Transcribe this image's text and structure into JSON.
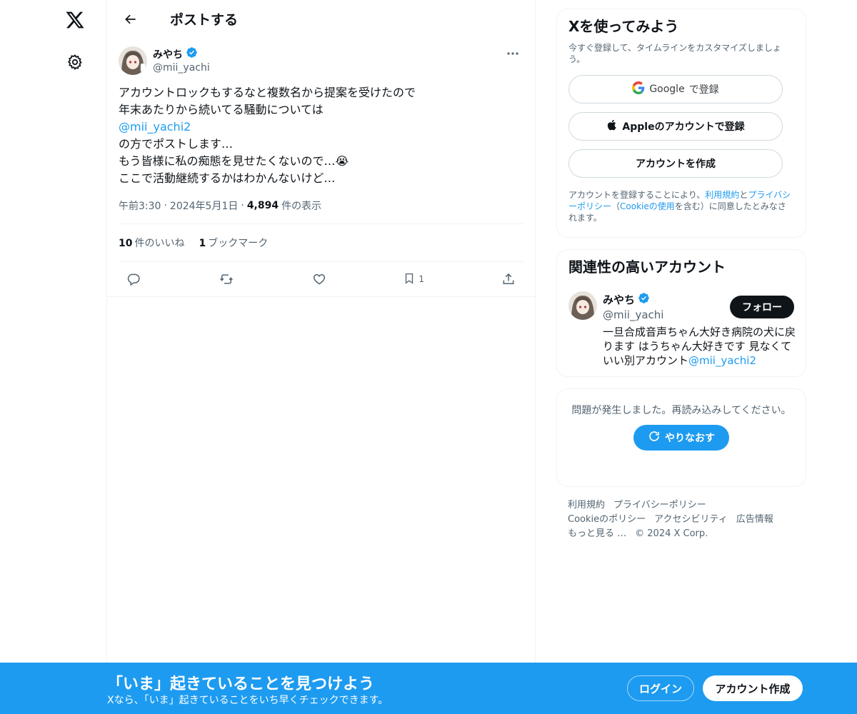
{
  "colors": {
    "accent": "#1d9bf0",
    "text": "#0f1419",
    "subtext": "#536471",
    "border": "#eff3f4",
    "dark_button": "#0f1419"
  },
  "nav": {
    "logo_icon": "x-logo-icon",
    "settings_icon": "gear-icon"
  },
  "header": {
    "back_icon": "arrow-left-icon",
    "title": "ポストする"
  },
  "post": {
    "author": {
      "name": "みやち",
      "handle": "@mii_yachi",
      "verified_icon": "verified-badge-icon"
    },
    "more_icon": "more-dots-icon",
    "text": {
      "line1": "アカウントロックもするなと複数名から提案を受けたので",
      "line2": "年末あたりから続いてる騒動については",
      "mention": "@mii_yachi2",
      "line4": "の方でポストします…",
      "line5": "もう皆様に私の痴態を見せたくないので…😭",
      "line6": "ここで活動継続するかはわかんないけど…"
    },
    "time": "午前3:30",
    "dot1": "·",
    "date": "2024年5月1日",
    "dot2": "·",
    "views_count": "4,894",
    "views_label": "件の表示",
    "likes_count": "10",
    "likes_label": "件のいいね",
    "bookmarks_count": "1",
    "bookmarks_label": "ブックマーク",
    "actions": {
      "reply_icon": "reply-icon",
      "repost_icon": "repost-icon",
      "like_icon": "heart-icon",
      "bookmark_icon": "bookmark-icon",
      "bookmark_count": "1",
      "share_icon": "share-icon"
    }
  },
  "signup": {
    "title": "Xを使ってみよう",
    "subtitle": "今すぐ登録して、タイムラインをカスタマイズしましょう。",
    "google_word": "Google",
    "google_suffix": "で登録",
    "apple_label": "Appleのアカウントで登録",
    "create_label": "アカウントを作成",
    "legal": {
      "prefix": "アカウントを登録することにより、",
      "terms": "利用規約",
      "and": "と",
      "privacy": "プライバシーポリシー",
      "paren_open": "（",
      "cookie": "Cookieの使用",
      "rest": "を含む）に同意したとみなされます。"
    }
  },
  "related": {
    "title": "関連性の高いアカウント",
    "name": "みやち",
    "handle": "@mii_yachi",
    "follow_label": "フォロー",
    "bio_text": "一旦合成音声ちゃん大好き病院の犬に戻ります はうちゃん大好きです 見なくていい別アカウント",
    "bio_mention": "@mii_yachi2"
  },
  "error": {
    "message": "問題が発生しました。再読み込みしてください。",
    "retry_label": "やりなおす",
    "retry_icon": "refresh-icon"
  },
  "footer": {
    "terms": "利用規約",
    "privacy": "プライバシーポリシー",
    "cookie": "Cookieのポリシー",
    "accessibility": "アクセシビリティ",
    "ads": "広告情報",
    "more": "もっと見る …",
    "copyright": "© 2024 X Corp."
  },
  "banner": {
    "title": "「いま」起きていることを見つけよう",
    "subtitle": "Xなら、「いま」起きていることをいち早くチェックできます。",
    "login_label": "ログイン",
    "signup_label": "アカウント作成"
  }
}
